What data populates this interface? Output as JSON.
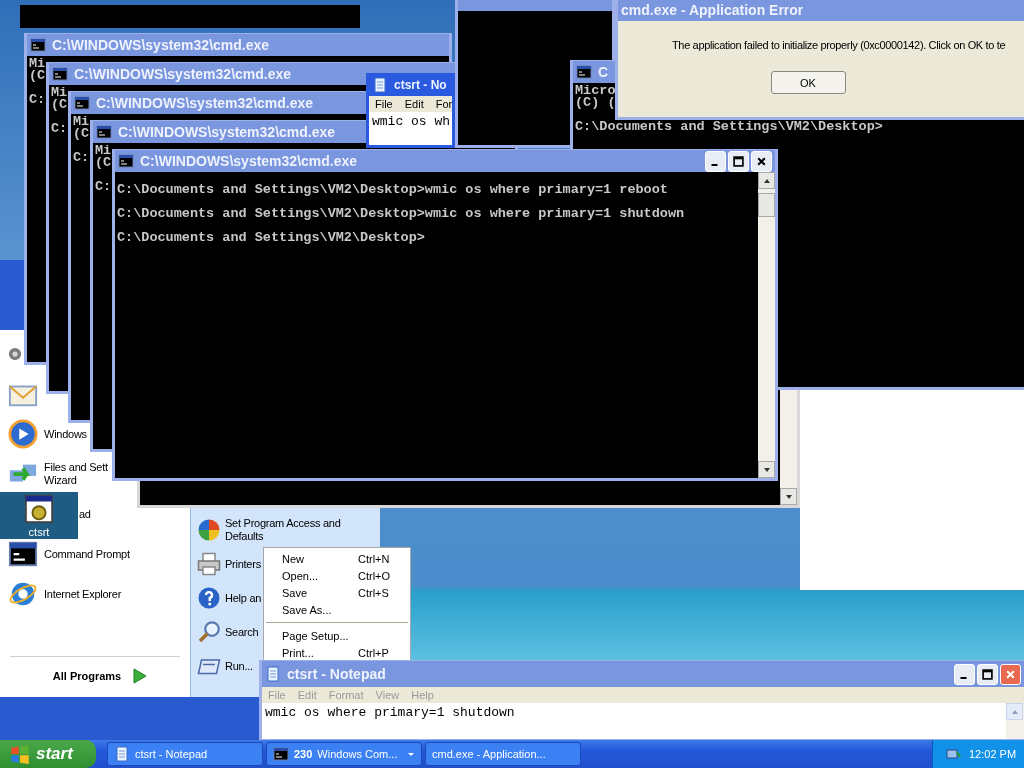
{
  "start_menu": {
    "left_items": [
      {
        "kind": "icon"
      },
      {
        "kind": "icon"
      },
      {
        "kind": "item",
        "lines": [
          "Windows"
        ]
      },
      {
        "kind": "item",
        "lines": [
          "Files and Sett",
          "Wizard"
        ]
      },
      {
        "kind": "hidden",
        "lines": [
          "ad"
        ]
      },
      {
        "kind": "item",
        "lines": [
          "Command Prompt"
        ]
      },
      {
        "kind": "item",
        "lines": [
          "Internet Explorer"
        ]
      }
    ],
    "all_programs": "All Programs",
    "right_items": [
      {
        "lines": [
          "Set Program Access and",
          "Defaults"
        ]
      },
      {
        "lines": [
          "Printers"
        ]
      },
      {
        "lines": [
          "Help an"
        ]
      },
      {
        "lines": [
          "Search"
        ]
      },
      {
        "lines": [
          "Run..."
        ]
      }
    ]
  },
  "stacked_cmd_windows": [
    {
      "title": "C:\\WINDOWS\\system32\\cmd.exe",
      "output": [
        "Mi",
        "(C"
      ],
      "prompts": [
        "C:"
      ]
    },
    {
      "title": "C:\\WINDOWS\\system32\\cmd.exe",
      "output": [
        "Mi",
        "(C"
      ],
      "prompts": [
        "C:"
      ]
    },
    {
      "title": "C:\\WINDOWS\\system32\\cmd.exe",
      "output": [
        "Mi",
        "(C"
      ],
      "prompts": [
        "C:"
      ]
    },
    {
      "title": "C:\\WINDOWS\\system32\\cmd.exe",
      "output": [
        "Mi",
        "(C"
      ],
      "prompts": [
        "C:"
      ]
    }
  ],
  "small_notepad": {
    "title": "ctsrt - No",
    "menu": [
      "File",
      "Edit",
      "For"
    ],
    "text": "wmic os wh"
  },
  "right_cmd": {
    "title": "C",
    "output": [
      "Micro",
      "(C) ("
    ],
    "prompts": [
      "C:\\Documents and Settings\\VM2\\Desktop>"
    ]
  },
  "error_dialog": {
    "title": "cmd.exe - Application Error",
    "message": "The application failed to initialize properly (0xc0000142). Click on OK to te",
    "button": "OK"
  },
  "main_cmd": {
    "title": "C:\\WINDOWS\\system32\\cmd.exe",
    "prompts": [
      "C:\\Documents and Settings\\VM2\\Desktop>wmic os where primary=1 reboot",
      "C:\\Documents and Settings\\VM2\\Desktop>wmic os where primary=1 shutdown",
      "C:\\Documents and Settings\\VM2\\Desktop>"
    ]
  },
  "desktop_icons": [
    {
      "label": "ctsrt",
      "selected": true
    }
  ],
  "file_menu": [
    {
      "kind": "item",
      "label": "New",
      "shortcut": "Ctrl+N"
    },
    {
      "kind": "item",
      "label": "Open...",
      "shortcut": "Ctrl+O"
    },
    {
      "kind": "item",
      "label": "Save",
      "shortcut": "Ctrl+S"
    },
    {
      "kind": "item",
      "label": "Save As..."
    },
    {
      "kind": "separator"
    },
    {
      "kind": "item",
      "label": "Page Setup..."
    },
    {
      "kind": "item",
      "label": "Print...",
      "shortcut": "Ctrl+P"
    }
  ],
  "notepad": {
    "title": "ctsrt - Notepad",
    "menu": [
      "File",
      "Edit",
      "Format",
      "View",
      "Help"
    ],
    "text": "wmic os where primary=1 shutdown"
  },
  "taskbar": {
    "start": "start",
    "tasks": [
      {
        "label": "ctsrt - Notepad",
        "group": false,
        "selected": false
      },
      {
        "count": "230",
        "label": "Windows Com...",
        "group": true,
        "selected": false
      },
      {
        "label": "cmd.exe - Application...",
        "group": false,
        "selected": false
      }
    ],
    "clock": "12:02 PM"
  }
}
